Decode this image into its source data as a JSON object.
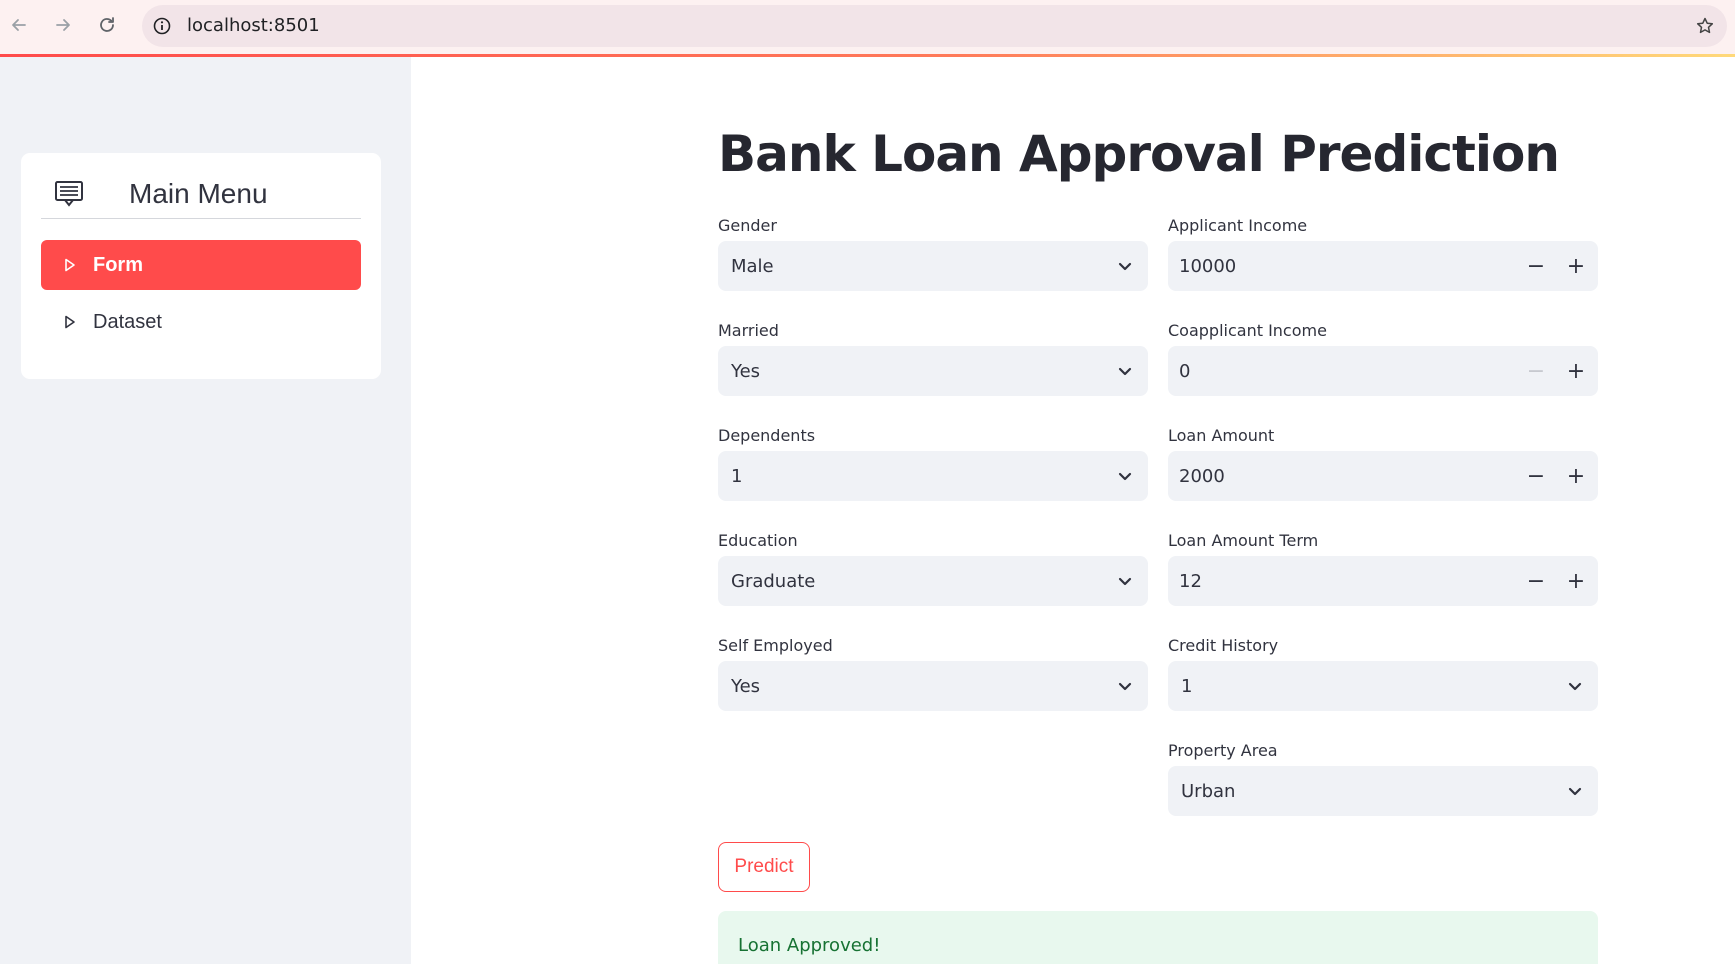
{
  "browser": {
    "url": "localhost:8501"
  },
  "sidebar": {
    "menu_title": "Main Menu",
    "items": [
      {
        "label": "Form",
        "active": true
      },
      {
        "label": "Dataset",
        "active": false
      }
    ]
  },
  "main": {
    "title": "Bank Loan Approval Prediction",
    "left_fields": [
      {
        "label": "Gender",
        "value": "Male"
      },
      {
        "label": "Married",
        "value": "Yes"
      },
      {
        "label": "Dependents",
        "value": "1"
      },
      {
        "label": "Education",
        "value": "Graduate"
      },
      {
        "label": "Self Employed",
        "value": "Yes"
      }
    ],
    "right_fields": [
      {
        "label": "Applicant Income",
        "value": "10000"
      },
      {
        "label": "Coapplicant Income",
        "value": "0"
      },
      {
        "label": "Loan Amount",
        "value": "2000"
      },
      {
        "label": "Loan Amount Term",
        "value": "12"
      },
      {
        "label": "Credit History",
        "value": "1"
      },
      {
        "label": "Property Area",
        "value": "Urban"
      }
    ],
    "predict_label": "Predict",
    "result_message": "Loan Approved!"
  },
  "colors": {
    "accent": "#ff4b4b",
    "success_bg": "#e8f8ee",
    "success_text": "#177233",
    "input_bg": "#f0f2f6"
  },
  "icons": {
    "back": "arrow-left-icon",
    "forward": "arrow-right-icon",
    "reload": "reload-icon",
    "site_info": "info-icon",
    "bookmark": "star-icon",
    "menu": "list-alt-icon",
    "menu_item": "caret-right-icon",
    "dropdown": "chevron-down-icon"
  }
}
